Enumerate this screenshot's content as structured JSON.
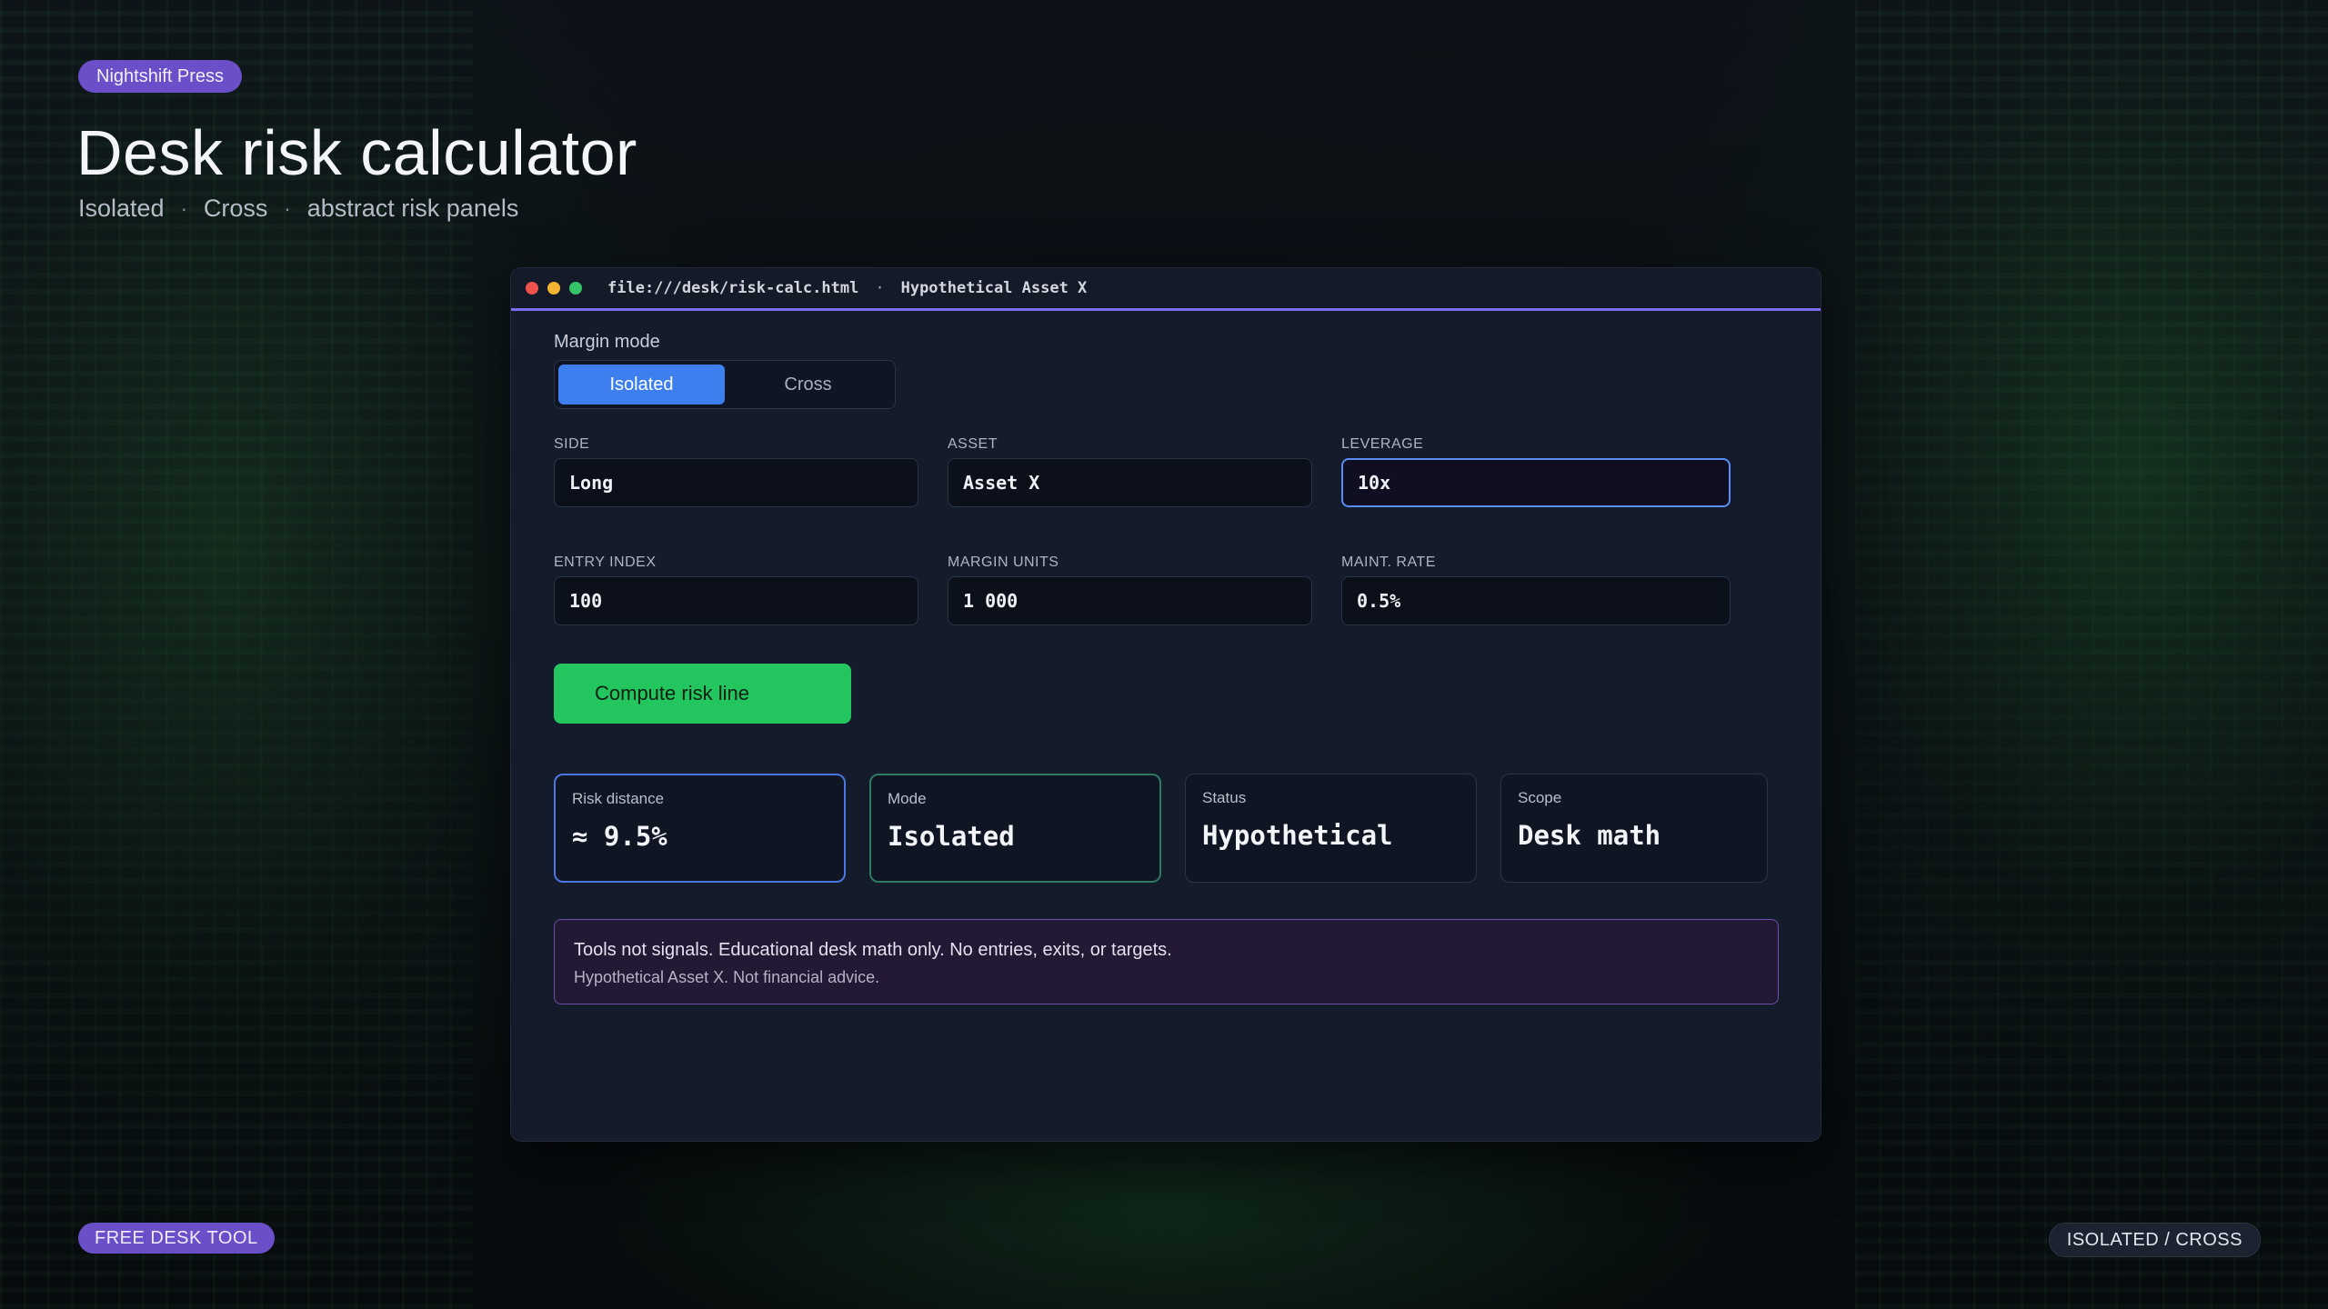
{
  "brand": "Nightshift Press",
  "hero": {
    "title": "Desk risk calculator",
    "sub": [
      "Isolated",
      "Cross",
      "abstract risk panels"
    ],
    "separator": "·"
  },
  "window": {
    "url": "file:///desk/risk-calc.html",
    "separator": "·",
    "asset_title": "Hypothetical Asset X",
    "controls": [
      "close",
      "minimize",
      "maximize"
    ]
  },
  "margin_mode": {
    "label": "Margin mode",
    "options": [
      "Isolated",
      "Cross"
    ],
    "selected": "Isolated"
  },
  "fields": {
    "side": {
      "label": "SIDE",
      "value": "Long"
    },
    "asset": {
      "label": "ASSET",
      "value": "Asset X"
    },
    "leverage": {
      "label": "LEVERAGE",
      "value": "10x"
    },
    "entry_index": {
      "label": "ENTRY INDEX",
      "value": "100"
    },
    "margin_units": {
      "label": "MARGIN UNITS",
      "value": "1 000"
    },
    "maint_rate": {
      "label": "MAINT. RATE",
      "value": "0.5%"
    }
  },
  "compute_label": "Compute risk line",
  "cards": [
    {
      "label": "Risk distance",
      "value": "≈ 9.5%"
    },
    {
      "label": "Mode",
      "value": "Isolated"
    },
    {
      "label": "Status",
      "value": "Hypothetical"
    },
    {
      "label": "Scope",
      "value": "Desk math"
    }
  ],
  "notice": {
    "line1": "Tools not signals. Educational desk math only. No entries, exits, or targets.",
    "line2": "Hypothetical Asset X. Not financial advice."
  },
  "footer": {
    "left_badge": "FREE DESK TOOL",
    "right_badge": "ISOLATED / CROSS"
  },
  "colors": {
    "accent_purple": "#6a4fc9",
    "accent_blue": "#3e7ff0",
    "compute_green": "#22c55e",
    "titlebar_underline": "#7b6cf0"
  }
}
